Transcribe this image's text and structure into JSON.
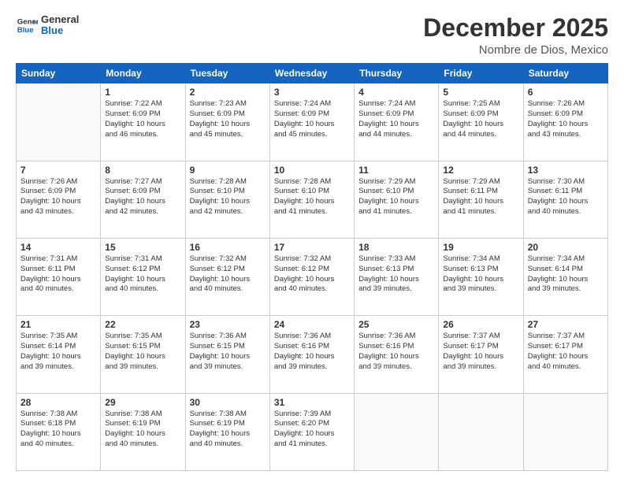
{
  "logo": {
    "line1": "General",
    "line2": "Blue"
  },
  "header": {
    "month_year": "December 2025",
    "location": "Nombre de Dios, Mexico"
  },
  "weekdays": [
    "Sunday",
    "Monday",
    "Tuesday",
    "Wednesday",
    "Thursday",
    "Friday",
    "Saturday"
  ],
  "weeks": [
    [
      {
        "day": "",
        "info": ""
      },
      {
        "day": "1",
        "info": "Sunrise: 7:22 AM\nSunset: 6:09 PM\nDaylight: 10 hours\nand 46 minutes."
      },
      {
        "day": "2",
        "info": "Sunrise: 7:23 AM\nSunset: 6:09 PM\nDaylight: 10 hours\nand 45 minutes."
      },
      {
        "day": "3",
        "info": "Sunrise: 7:24 AM\nSunset: 6:09 PM\nDaylight: 10 hours\nand 45 minutes."
      },
      {
        "day": "4",
        "info": "Sunrise: 7:24 AM\nSunset: 6:09 PM\nDaylight: 10 hours\nand 44 minutes."
      },
      {
        "day": "5",
        "info": "Sunrise: 7:25 AM\nSunset: 6:09 PM\nDaylight: 10 hours\nand 44 minutes."
      },
      {
        "day": "6",
        "info": "Sunrise: 7:26 AM\nSunset: 6:09 PM\nDaylight: 10 hours\nand 43 minutes."
      }
    ],
    [
      {
        "day": "7",
        "info": "Sunrise: 7:26 AM\nSunset: 6:09 PM\nDaylight: 10 hours\nand 43 minutes."
      },
      {
        "day": "8",
        "info": "Sunrise: 7:27 AM\nSunset: 6:09 PM\nDaylight: 10 hours\nand 42 minutes."
      },
      {
        "day": "9",
        "info": "Sunrise: 7:28 AM\nSunset: 6:10 PM\nDaylight: 10 hours\nand 42 minutes."
      },
      {
        "day": "10",
        "info": "Sunrise: 7:28 AM\nSunset: 6:10 PM\nDaylight: 10 hours\nand 41 minutes."
      },
      {
        "day": "11",
        "info": "Sunrise: 7:29 AM\nSunset: 6:10 PM\nDaylight: 10 hours\nand 41 minutes."
      },
      {
        "day": "12",
        "info": "Sunrise: 7:29 AM\nSunset: 6:11 PM\nDaylight: 10 hours\nand 41 minutes."
      },
      {
        "day": "13",
        "info": "Sunrise: 7:30 AM\nSunset: 6:11 PM\nDaylight: 10 hours\nand 40 minutes."
      }
    ],
    [
      {
        "day": "14",
        "info": "Sunrise: 7:31 AM\nSunset: 6:11 PM\nDaylight: 10 hours\nand 40 minutes."
      },
      {
        "day": "15",
        "info": "Sunrise: 7:31 AM\nSunset: 6:12 PM\nDaylight: 10 hours\nand 40 minutes."
      },
      {
        "day": "16",
        "info": "Sunrise: 7:32 AM\nSunset: 6:12 PM\nDaylight: 10 hours\nand 40 minutes."
      },
      {
        "day": "17",
        "info": "Sunrise: 7:32 AM\nSunset: 6:12 PM\nDaylight: 10 hours\nand 40 minutes."
      },
      {
        "day": "18",
        "info": "Sunrise: 7:33 AM\nSunset: 6:13 PM\nDaylight: 10 hours\nand 39 minutes."
      },
      {
        "day": "19",
        "info": "Sunrise: 7:34 AM\nSunset: 6:13 PM\nDaylight: 10 hours\nand 39 minutes."
      },
      {
        "day": "20",
        "info": "Sunrise: 7:34 AM\nSunset: 6:14 PM\nDaylight: 10 hours\nand 39 minutes."
      }
    ],
    [
      {
        "day": "21",
        "info": "Sunrise: 7:35 AM\nSunset: 6:14 PM\nDaylight: 10 hours\nand 39 minutes."
      },
      {
        "day": "22",
        "info": "Sunrise: 7:35 AM\nSunset: 6:15 PM\nDaylight: 10 hours\nand 39 minutes."
      },
      {
        "day": "23",
        "info": "Sunrise: 7:36 AM\nSunset: 6:15 PM\nDaylight: 10 hours\nand 39 minutes."
      },
      {
        "day": "24",
        "info": "Sunrise: 7:36 AM\nSunset: 6:16 PM\nDaylight: 10 hours\nand 39 minutes."
      },
      {
        "day": "25",
        "info": "Sunrise: 7:36 AM\nSunset: 6:16 PM\nDaylight: 10 hours\nand 39 minutes."
      },
      {
        "day": "26",
        "info": "Sunrise: 7:37 AM\nSunset: 6:17 PM\nDaylight: 10 hours\nand 39 minutes."
      },
      {
        "day": "27",
        "info": "Sunrise: 7:37 AM\nSunset: 6:17 PM\nDaylight: 10 hours\nand 40 minutes."
      }
    ],
    [
      {
        "day": "28",
        "info": "Sunrise: 7:38 AM\nSunset: 6:18 PM\nDaylight: 10 hours\nand 40 minutes."
      },
      {
        "day": "29",
        "info": "Sunrise: 7:38 AM\nSunset: 6:19 PM\nDaylight: 10 hours\nand 40 minutes."
      },
      {
        "day": "30",
        "info": "Sunrise: 7:38 AM\nSunset: 6:19 PM\nDaylight: 10 hours\nand 40 minutes."
      },
      {
        "day": "31",
        "info": "Sunrise: 7:39 AM\nSunset: 6:20 PM\nDaylight: 10 hours\nand 41 minutes."
      },
      {
        "day": "",
        "info": ""
      },
      {
        "day": "",
        "info": ""
      },
      {
        "day": "",
        "info": ""
      }
    ]
  ]
}
